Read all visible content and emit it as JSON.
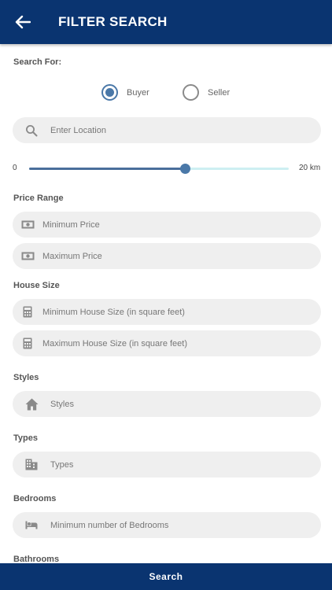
{
  "appbar": {
    "title": "FILTER SEARCH",
    "back_icon": "arrow-left-icon"
  },
  "search_for": {
    "label": "Search For:",
    "options": [
      {
        "label": "Buyer",
        "checked": true
      },
      {
        "label": "Seller",
        "checked": false
      }
    ]
  },
  "location": {
    "placeholder": "Enter Location",
    "icon": "search-icon"
  },
  "distance": {
    "min_label": "0",
    "max_label": "20 km",
    "min": 0,
    "max": 20,
    "value": 12
  },
  "price_range": {
    "label": "Price Range",
    "min_placeholder": "Minimum Price",
    "max_placeholder": "Maximum Price",
    "icon": "money-icon"
  },
  "house_size": {
    "label": "House Size",
    "min_placeholder": "Minimum House Size (in square feet)",
    "max_placeholder": "Maximum House Size (in square feet)",
    "icon": "calculator-icon"
  },
  "styles": {
    "label": "Styles",
    "placeholder": "Styles",
    "icon": "home-icon"
  },
  "types": {
    "label": "Types",
    "placeholder": "Types",
    "icon": "building-icon"
  },
  "bedrooms": {
    "label": "Bedrooms",
    "placeholder": "Minimum number of Bedrooms",
    "icon": "bed-icon"
  },
  "bathrooms": {
    "label": "Bathrooms"
  },
  "footer": {
    "search_label": "Search"
  },
  "colors": {
    "primary": "#0a3470",
    "accent": "#4a78a8",
    "field_bg": "#efefef"
  }
}
